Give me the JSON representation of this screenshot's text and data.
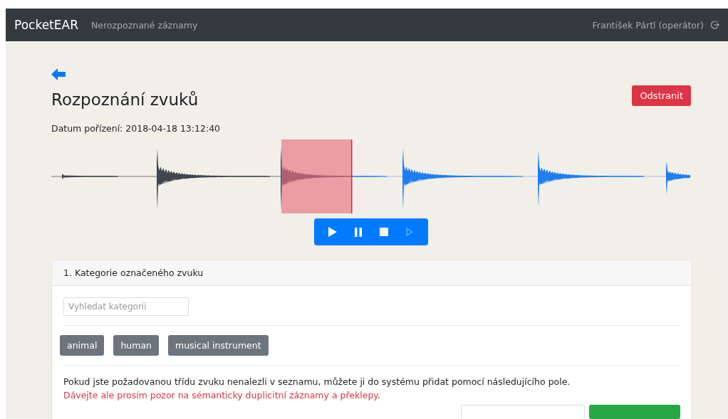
{
  "navbar": {
    "brand": "PocketEAR",
    "link": "Nerozpoznané záznamy",
    "user": "František Pártl (operátor)"
  },
  "title": "Rozpoznání zvuků",
  "delete_button": "Odstranit",
  "date": "Datum pořízení: 2018-04-18 13:12:40",
  "player": [
    {
      "kind": "play",
      "disabled": false
    },
    {
      "kind": "pause",
      "disabled": false
    },
    {
      "kind": "stop",
      "disabled": false
    },
    {
      "kind": "next",
      "disabled": true
    }
  ],
  "category_card": {
    "header": "1. Kategorie označeného zvuku",
    "search": {
      "placeholder": "Vyhledat kategorii"
    },
    "categories": [
      "animal",
      "human",
      "musical instrument"
    ],
    "note": "Pokud jste požadovanou třídu zvuku nenalezli v seznamu, můžete ji do systému přidat pomocí následujícího pole.",
    "warning": "Dávejte ale prosím pozor na sémanticky duplicitní záznamy a překlepy",
    "warning_end": "."
  }
}
